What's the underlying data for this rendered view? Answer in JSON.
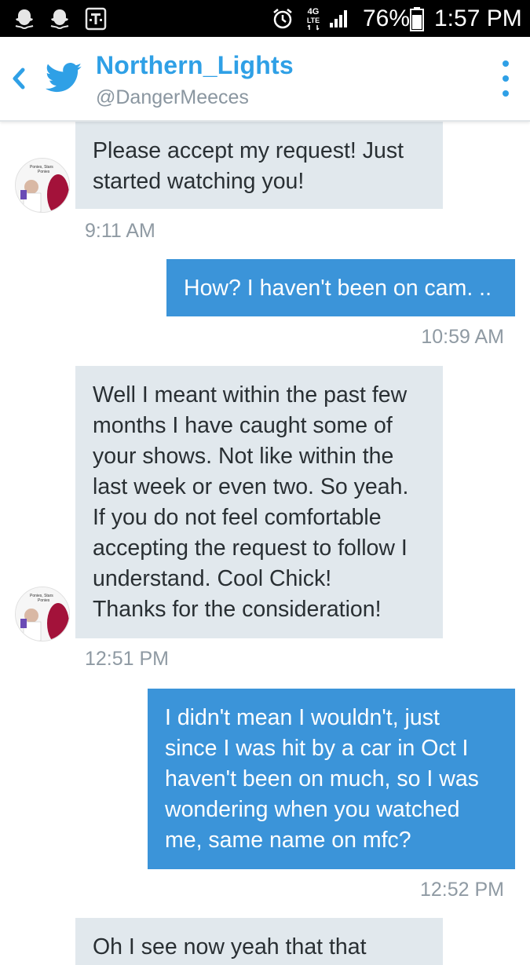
{
  "status_bar": {
    "battery": "76%",
    "time": "1:57 PM",
    "network": "4G LTE"
  },
  "header": {
    "title": "Northern_Lights",
    "handle": "@DangerMeeces",
    "accent_color": "#2fa0e6"
  },
  "avatar": {
    "caption_line1": "Ponies, Stars",
    "caption_line2": "Ponies"
  },
  "messages": [
    {
      "direction": "incoming",
      "text": "Please accept my request!  Just\nstarted watching you!",
      "time": "9:11 AM"
    },
    {
      "direction": "outgoing",
      "text": "How? I haven't been on cam. ..",
      "time": "10:59 AM"
    },
    {
      "direction": "incoming",
      "text": "Well I meant within the past few\nmonths I have caught some of\nyour shows.  Not like within the\nlast week or even two.  So yeah.\nIf you do not feel comfortable\naccepting the request to follow I\nunderstand.  Cool Chick!\nThanks for the consideration!",
      "time": "12:51 PM"
    },
    {
      "direction": "outgoing",
      "text": "I didn't mean I wouldn't,  just\nsince I was hit by a car in Oct I\nhaven't been on much, so I was\nwondering when you watched\nme, same name on mfc?",
      "time": "12:52 PM"
    },
    {
      "direction": "incoming",
      "text": "Oh I see now yeah that that",
      "time": ""
    }
  ],
  "colors": {
    "incoming_bubble": "#e1e8ed",
    "outgoing_bubble": "#3b94d9",
    "timestamp": "#8f9aa3"
  }
}
